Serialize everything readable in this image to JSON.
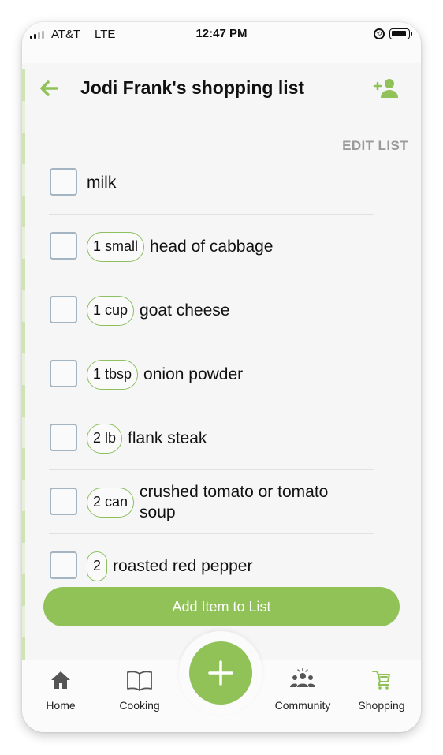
{
  "status_bar": {
    "carrier": "AT&T",
    "network": "LTE",
    "time": "12:47 PM"
  },
  "header": {
    "title": "Jodi Frank's shopping list",
    "back_icon": "arrow-left-icon",
    "add_user_icon": "add-person-icon"
  },
  "edit_list_label": "EDIT LIST",
  "items": [
    {
      "qty": "",
      "name": "milk",
      "checked": false
    },
    {
      "qty": "1 small",
      "name": "head of cabbage",
      "checked": false
    },
    {
      "qty": "1 cup",
      "name": "goat cheese",
      "checked": false
    },
    {
      "qty": "1 tbsp",
      "name": "onion powder",
      "checked": false
    },
    {
      "qty": "2 lb",
      "name": "flank steak",
      "checked": false
    },
    {
      "qty": "2 can",
      "name": "crushed tomato or tomato soup",
      "checked": false
    },
    {
      "qty": "2",
      "name": "roasted red pepper",
      "checked": false
    }
  ],
  "add_item_label": "Add Item to List",
  "bottom_nav": [
    {
      "label": "Home",
      "icon": "home-icon"
    },
    {
      "label": "Cooking",
      "icon": "book-icon"
    },
    {
      "label": "Community",
      "icon": "community-icon"
    },
    {
      "label": "Shopping",
      "icon": "cart-icon",
      "active": true
    }
  ],
  "colors": {
    "accent": "#90c258",
    "chip_border": "#8cc060",
    "checkbox_border": "#a3b4c2",
    "edit_list": "#9a9a9a"
  }
}
